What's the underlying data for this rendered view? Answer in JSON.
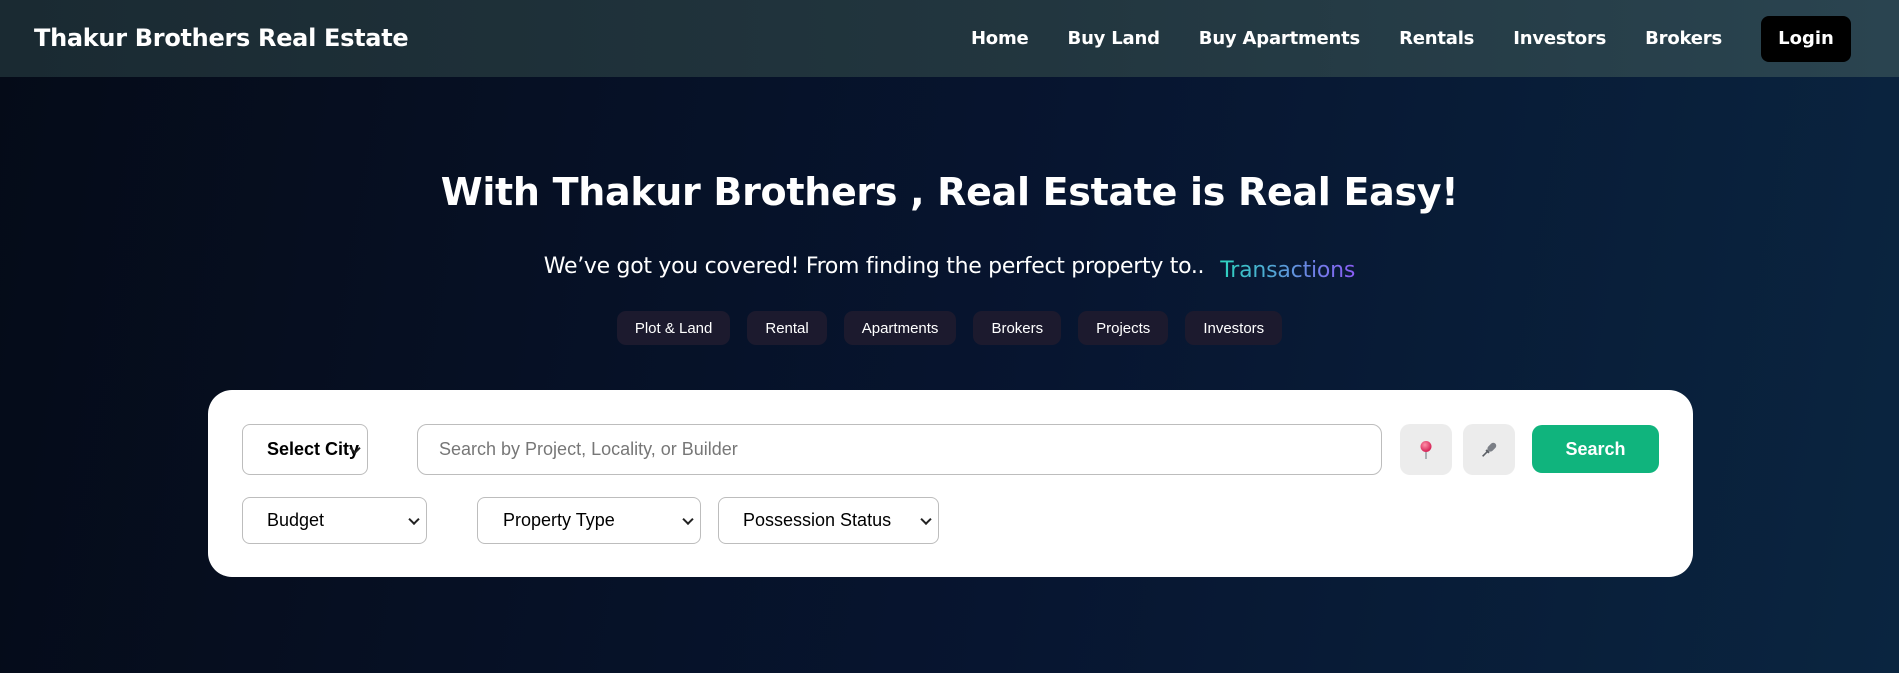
{
  "navbar": {
    "brand": "Thakur Brothers Real Estate",
    "links": [
      "Home",
      "Buy Land",
      "Buy Apartments",
      "Rentals",
      "Investors",
      "Brokers"
    ],
    "login_label": "Login"
  },
  "hero": {
    "title": "With Thakur Brothers , Real Estate is Real Easy!",
    "subtitle": "We’ve got you covered! From finding the perfect property to..",
    "rotating_word": "Transactions",
    "chips": [
      "Plot & Land",
      "Rental",
      "Apartments",
      "Brokers",
      "Projects",
      "Investors"
    ]
  },
  "search": {
    "city_select": "Select City",
    "placeholder": "Search by Project, Locality, or Builder",
    "value": "",
    "location_icon": "map-pin-icon",
    "voice_icon": "microphone-icon",
    "button_label": "Search",
    "filters": {
      "budget": "Budget",
      "property_type": "Property Type",
      "possession_status": "Possession Status"
    }
  },
  "colors": {
    "search_button": "#10b47d",
    "chip_bg": "#1c1a2e",
    "login_bg": "#000000",
    "rotating_gradient_start": "#2dd4bf",
    "rotating_gradient_end": "#8b5cf6"
  }
}
